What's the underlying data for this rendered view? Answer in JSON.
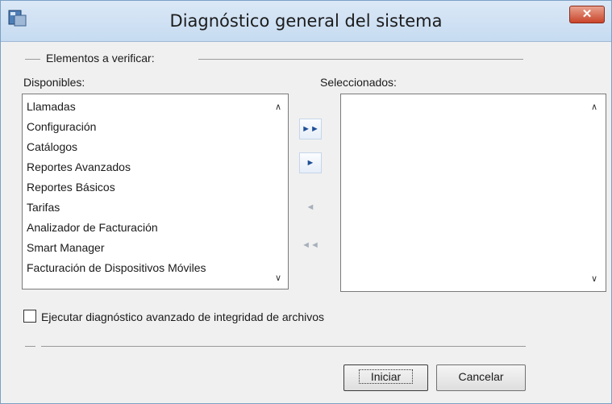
{
  "window": {
    "title": "Diagnóstico general del sistema",
    "close_label": "✕",
    "app_icon": "app-icon"
  },
  "group": {
    "title": "Elementos a verificar:"
  },
  "available": {
    "label": "Disponibles:",
    "items": [
      "Llamadas",
      "Configuración",
      "Catálogos",
      "Reportes Avanzados",
      "Reportes Básicos",
      "Tarifas",
      "Analizador de Facturación",
      "Smart Manager",
      "Facturación de Dispositivos Móviles"
    ]
  },
  "selected": {
    "label": "Seleccionados:",
    "items": []
  },
  "move_buttons": {
    "add_all": "►►",
    "add_one": "►",
    "remove_one": "◄",
    "remove_all": "◄◄"
  },
  "option": {
    "checked": false,
    "label": "Ejecutar diagnóstico avanzado de integridad de archivos"
  },
  "actions": {
    "start": "Iniciar",
    "cancel": "Cancelar"
  },
  "scroll": {
    "up": "∧",
    "down": "∨"
  }
}
